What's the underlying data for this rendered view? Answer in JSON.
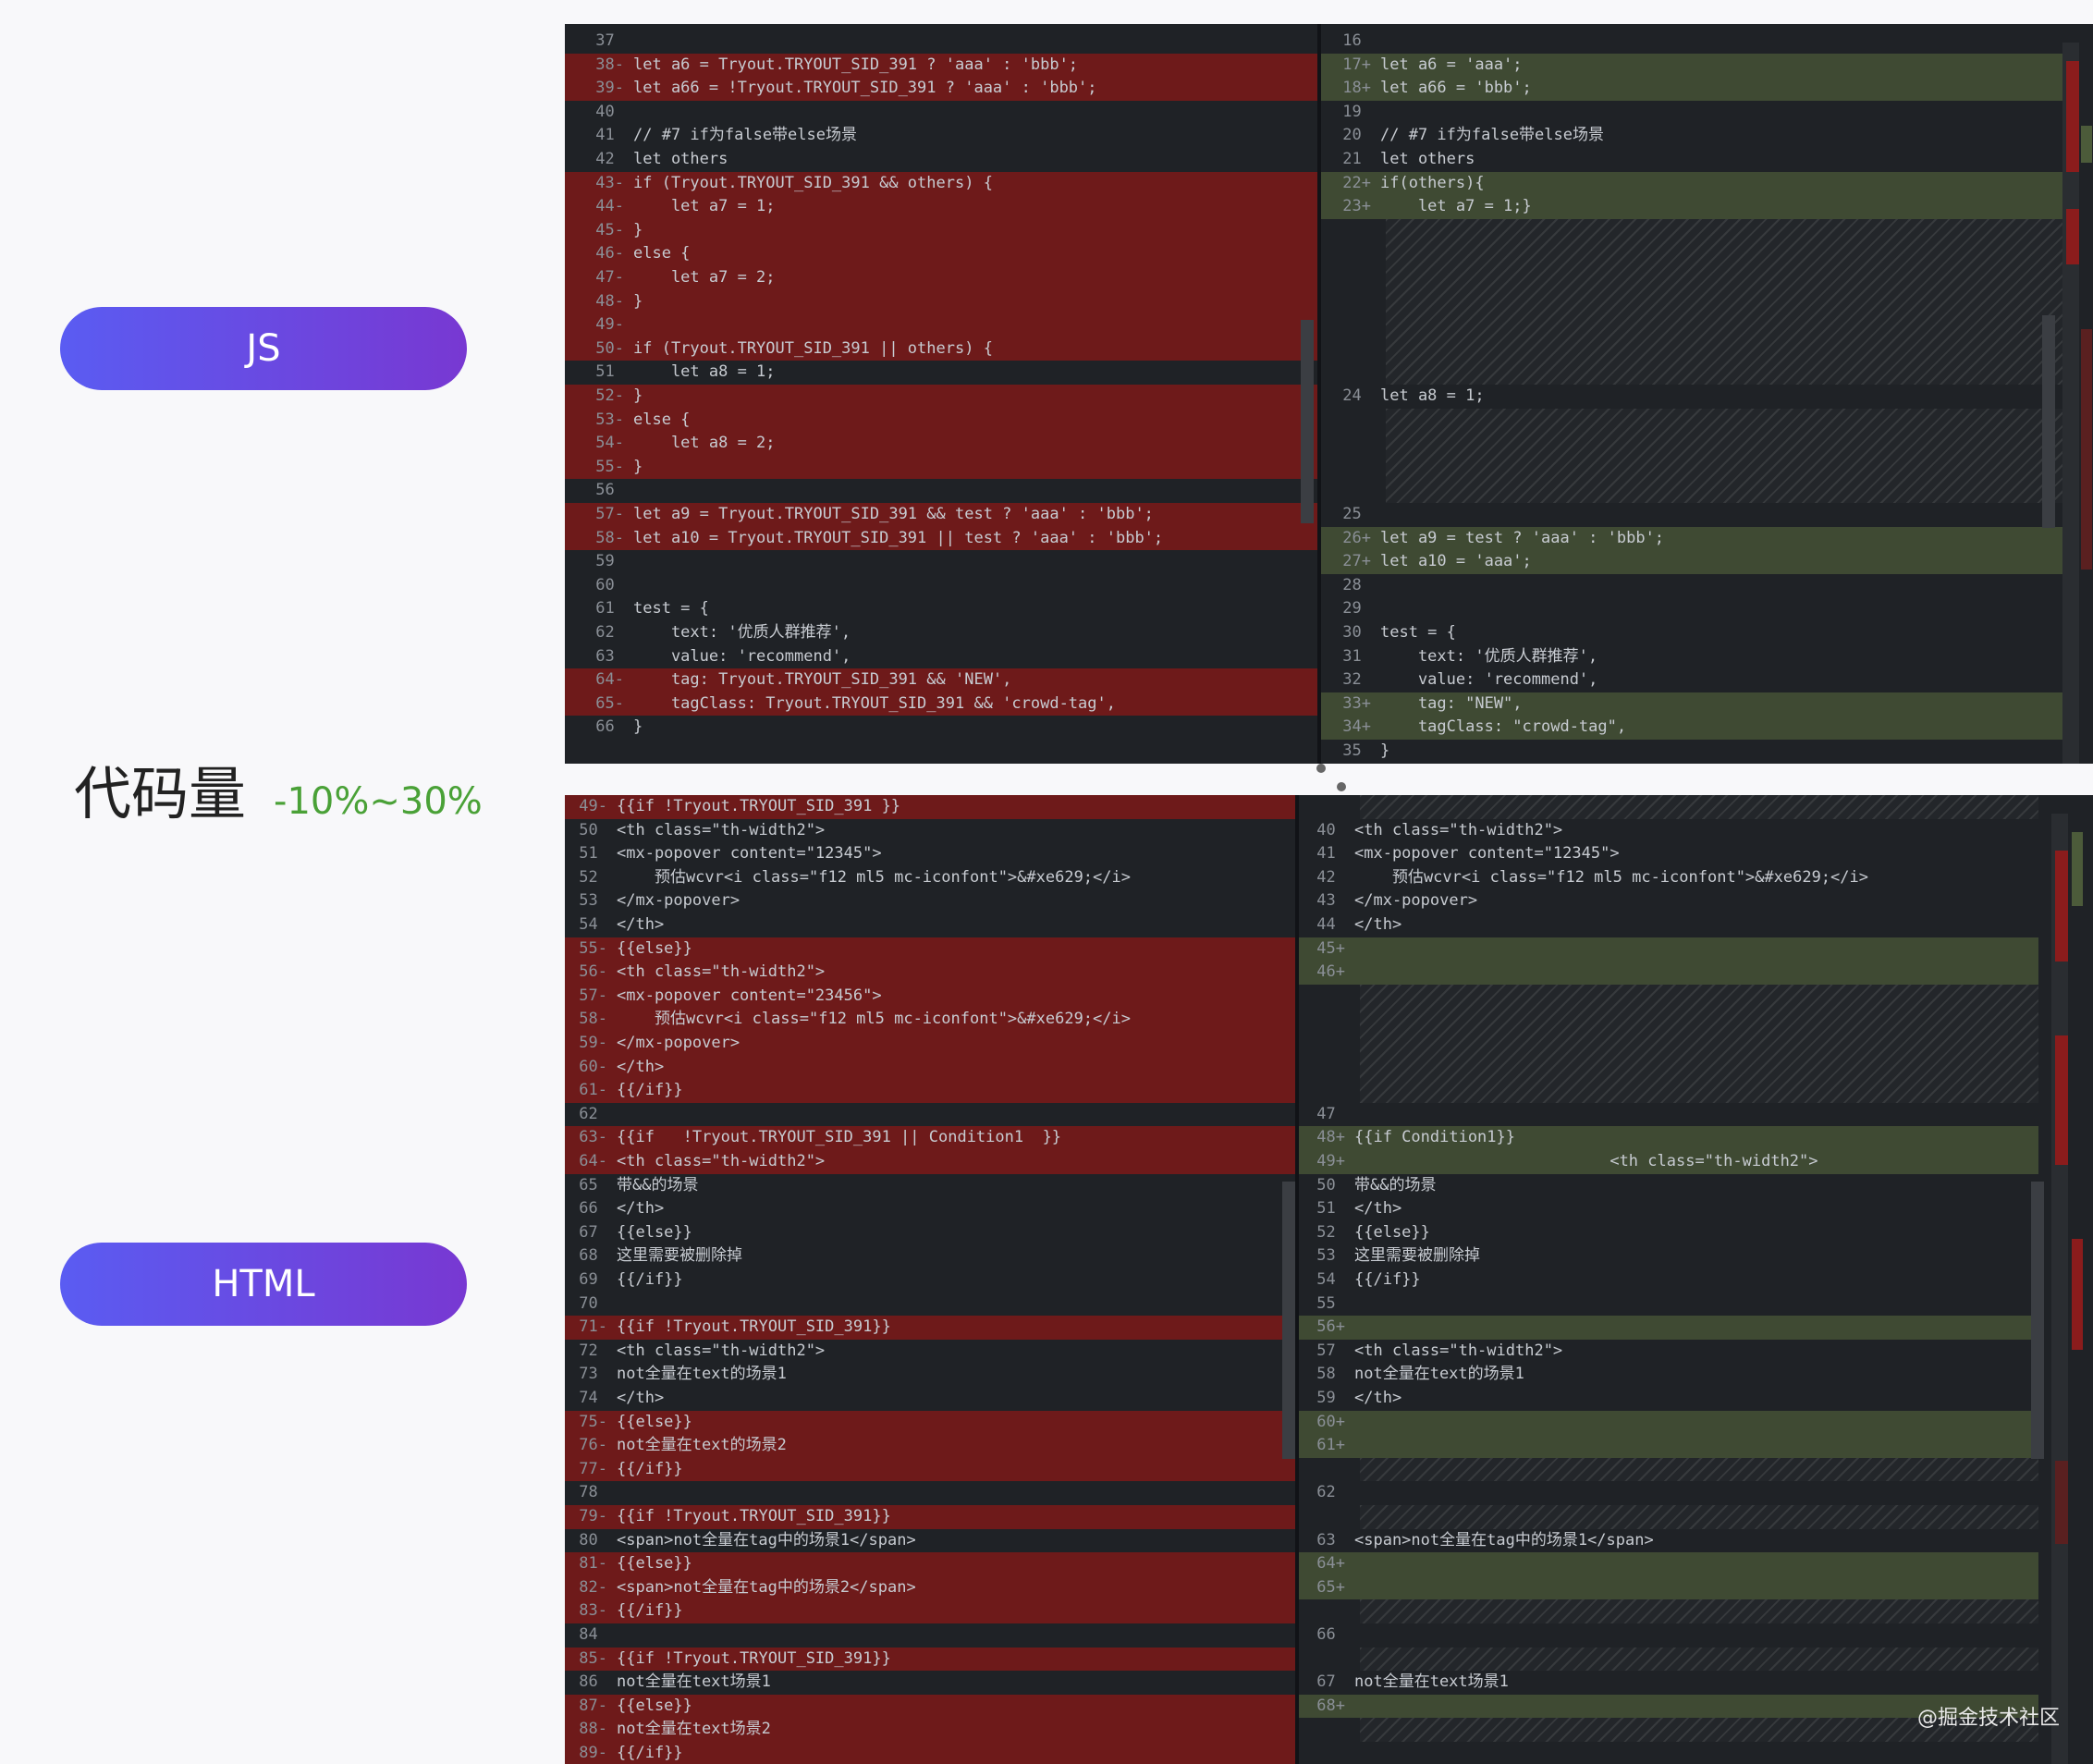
{
  "labels": {
    "js": "JS",
    "html": "HTML",
    "metric_name": "代码量",
    "metric_value": "-10%~30%"
  },
  "watermark": "@掘金技术社区",
  "js_diff": {
    "left": [
      {
        "n": "37",
        "t": "",
        "k": "ctx"
      },
      {
        "n": "38",
        "m": "-",
        "t": "let a6 = Tryout.TRYOUT_SID_391 ? 'aaa' : 'bbb';",
        "k": "del"
      },
      {
        "n": "39",
        "m": "-",
        "t": "let a66 = !Tryout.TRYOUT_SID_391 ? 'aaa' : 'bbb';",
        "k": "del"
      },
      {
        "n": "40",
        "t": "",
        "k": "ctx"
      },
      {
        "n": "41",
        "t": "// #7 if为false带else场景",
        "k": "ctx"
      },
      {
        "n": "42",
        "t": "let others",
        "k": "ctx"
      },
      {
        "n": "43",
        "m": "-",
        "t": "if (Tryout.TRYOUT_SID_391 && others) {",
        "k": "del"
      },
      {
        "n": "44",
        "m": "-",
        "t": "    let a7 = 1;",
        "k": "del"
      },
      {
        "n": "45",
        "m": "-",
        "t": "}",
        "k": "del"
      },
      {
        "n": "46",
        "m": "-",
        "t": "else {",
        "k": "del"
      },
      {
        "n": "47",
        "m": "-",
        "t": "    let a7 = 2;",
        "k": "del"
      },
      {
        "n": "48",
        "m": "-",
        "t": "}",
        "k": "del"
      },
      {
        "n": "49",
        "m": "-",
        "t": "",
        "k": "del"
      },
      {
        "n": "50",
        "m": "-",
        "t": "if (Tryout.TRYOUT_SID_391 || others) {",
        "k": "del"
      },
      {
        "n": "51",
        "t": "    let a8 = 1;",
        "k": "ctx"
      },
      {
        "n": "52",
        "m": "-",
        "t": "}",
        "k": "del"
      },
      {
        "n": "53",
        "m": "-",
        "t": "else {",
        "k": "del"
      },
      {
        "n": "54",
        "m": "-",
        "t": "    let a8 = 2;",
        "k": "del"
      },
      {
        "n": "55",
        "m": "-",
        "t": "}",
        "k": "del"
      },
      {
        "n": "56",
        "t": "",
        "k": "ctx"
      },
      {
        "n": "57",
        "m": "-",
        "t": "let a9 = Tryout.TRYOUT_SID_391 && test ? 'aaa' : 'bbb';",
        "k": "del"
      },
      {
        "n": "58",
        "m": "-",
        "t": "let a10 = Tryout.TRYOUT_SID_391 || test ? 'aaa' : 'bbb';",
        "k": "del"
      },
      {
        "n": "59",
        "t": "",
        "k": "ctx"
      },
      {
        "n": "60",
        "t": "",
        "k": "ctx"
      },
      {
        "n": "61",
        "t": "test = {",
        "k": "ctx"
      },
      {
        "n": "62",
        "t": "    text: '优质人群推荐',",
        "k": "ctx"
      },
      {
        "n": "63",
        "t": "    value: 'recommend',",
        "k": "ctx"
      },
      {
        "n": "64",
        "m": "-",
        "t": "    tag: Tryout.TRYOUT_SID_391 && 'NEW',",
        "k": "del"
      },
      {
        "n": "65",
        "m": "-",
        "t": "    tagClass: Tryout.TRYOUT_SID_391 && 'crowd-tag',",
        "k": "del"
      },
      {
        "n": "66",
        "t": "}",
        "k": "ctx"
      }
    ],
    "right": [
      {
        "n": "16",
        "t": "",
        "k": "ctx"
      },
      {
        "n": "17",
        "m": "+",
        "t": "let a6 = 'aaa';",
        "k": "add"
      },
      {
        "n": "18",
        "m": "+",
        "t": "let a66 = 'bbb';",
        "k": "add"
      },
      {
        "n": "19",
        "t": "",
        "k": "ctx"
      },
      {
        "n": "20",
        "t": "// #7 if为false带else场景",
        "k": "ctx"
      },
      {
        "n": "21",
        "t": "let others",
        "k": "ctx"
      },
      {
        "n": "22",
        "m": "+",
        "t": "if(others){",
        "k": "add"
      },
      {
        "n": "23",
        "m": "+",
        "t": "    let a7 = 1;}",
        "k": "add"
      },
      {
        "gap": 7
      },
      {
        "n": "24",
        "t": "let a8 = 1;",
        "k": "ctx"
      },
      {
        "gap": 4
      },
      {
        "n": "25",
        "t": "",
        "k": "ctx"
      },
      {
        "n": "26",
        "m": "+",
        "t": "let a9 = test ? 'aaa' : 'bbb';",
        "k": "add"
      },
      {
        "n": "27",
        "m": "+",
        "t": "let a10 = 'aaa';",
        "k": "add"
      },
      {
        "n": "28",
        "t": "",
        "k": "ctx"
      },
      {
        "n": "29",
        "t": "",
        "k": "ctx"
      },
      {
        "n": "30",
        "t": "test = {",
        "k": "ctx"
      },
      {
        "n": "31",
        "t": "    text: '优质人群推荐',",
        "k": "ctx"
      },
      {
        "n": "32",
        "t": "    value: 'recommend',",
        "k": "ctx"
      },
      {
        "n": "33",
        "m": "+",
        "t": "    tag: \"NEW\",",
        "k": "add"
      },
      {
        "n": "34",
        "m": "+",
        "t": "    tagClass: \"crowd-tag\",",
        "k": "add"
      },
      {
        "n": "35",
        "t": "}",
        "k": "ctx"
      }
    ]
  },
  "html_diff": {
    "left": [
      {
        "n": "49",
        "m": "-",
        "t": "{{if !Tryout.TRYOUT_SID_391 }}",
        "k": "del"
      },
      {
        "n": "50",
        "t": "<th class=\"th-width2\">",
        "k": "ctx"
      },
      {
        "n": "51",
        "t": "<mx-popover content=\"12345\">",
        "k": "ctx"
      },
      {
        "n": "52",
        "t": "    预估wcvr<i class=\"f12 ml5 mc-iconfont\">&#xe629;</i>",
        "k": "ctx"
      },
      {
        "n": "53",
        "t": "</mx-popover>",
        "k": "ctx"
      },
      {
        "n": "54",
        "t": "</th>",
        "k": "ctx"
      },
      {
        "n": "55",
        "m": "-",
        "t": "{{else}}",
        "k": "del"
      },
      {
        "n": "56",
        "m": "-",
        "t": "<th class=\"th-width2\">",
        "k": "del"
      },
      {
        "n": "57",
        "m": "-",
        "t": "<mx-popover content=\"23456\">",
        "k": "del"
      },
      {
        "n": "58",
        "m": "-",
        "t": "    预估wcvr<i class=\"f12 ml5 mc-iconfont\">&#xe629;</i>",
        "k": "del"
      },
      {
        "n": "59",
        "m": "-",
        "t": "</mx-popover>",
        "k": "del"
      },
      {
        "n": "60",
        "m": "-",
        "t": "</th>",
        "k": "del"
      },
      {
        "n": "61",
        "m": "-",
        "t": "{{/if}}",
        "k": "del"
      },
      {
        "n": "62",
        "t": "",
        "k": "ctx"
      },
      {
        "n": "63",
        "m": "-",
        "t": "{{if   !Tryout.TRYOUT_SID_391 || Condition1  }}",
        "k": "del"
      },
      {
        "n": "64",
        "m": "-",
        "t": "<th class=\"th-width2\">",
        "k": "del"
      },
      {
        "n": "65",
        "t": "带&&的场景",
        "k": "ctx"
      },
      {
        "n": "66",
        "t": "</th>",
        "k": "ctx"
      },
      {
        "n": "67",
        "t": "{{else}}",
        "k": "ctx"
      },
      {
        "n": "68",
        "t": "这里需要被删除掉",
        "k": "ctx"
      },
      {
        "n": "69",
        "t": "{{/if}}",
        "k": "ctx"
      },
      {
        "n": "70",
        "t": "",
        "k": "ctx"
      },
      {
        "n": "71",
        "m": "-",
        "t": "{{if !Tryout.TRYOUT_SID_391}}",
        "k": "del"
      },
      {
        "n": "72",
        "t": "<th class=\"th-width2\">",
        "k": "ctx"
      },
      {
        "n": "73",
        "t": "not全量在text的场景1",
        "k": "ctx"
      },
      {
        "n": "74",
        "t": "</th>",
        "k": "ctx"
      },
      {
        "n": "75",
        "m": "-",
        "t": "{{else}}",
        "k": "del"
      },
      {
        "n": "76",
        "m": "-",
        "t": "not全量在text的场景2",
        "k": "del"
      },
      {
        "n": "77",
        "m": "-",
        "t": "{{/if}}",
        "k": "del"
      },
      {
        "n": "78",
        "t": "",
        "k": "ctx"
      },
      {
        "n": "79",
        "m": "-",
        "t": "{{if !Tryout.TRYOUT_SID_391}}",
        "k": "del"
      },
      {
        "n": "80",
        "t": "<span>not全量在tag中的场景1</span>",
        "k": "ctx"
      },
      {
        "n": "81",
        "m": "-",
        "t": "{{else}}",
        "k": "del"
      },
      {
        "n": "82",
        "m": "-",
        "t": "<span>not全量在tag中的场景2</span>",
        "k": "del"
      },
      {
        "n": "83",
        "m": "-",
        "t": "{{/if}}",
        "k": "del"
      },
      {
        "n": "84",
        "t": "",
        "k": "ctx"
      },
      {
        "n": "85",
        "m": "-",
        "t": "{{if !Tryout.TRYOUT_SID_391}}",
        "k": "del"
      },
      {
        "n": "86",
        "t": "not全量在text场景1",
        "k": "ctx"
      },
      {
        "n": "87",
        "m": "-",
        "t": "{{else}}",
        "k": "del"
      },
      {
        "n": "88",
        "m": "-",
        "t": "not全量在text场景2",
        "k": "del"
      },
      {
        "n": "89",
        "m": "-",
        "t": "{{/if}}",
        "k": "del"
      }
    ],
    "right": [
      {
        "gap": 1
      },
      {
        "n": "40",
        "t": "<th class=\"th-width2\">",
        "k": "ctx"
      },
      {
        "n": "41",
        "t": "<mx-popover content=\"12345\">",
        "k": "ctx"
      },
      {
        "n": "42",
        "t": "    预估wcvr<i class=\"f12 ml5 mc-iconfont\">&#xe629;</i>",
        "k": "ctx"
      },
      {
        "n": "43",
        "t": "</mx-popover>",
        "k": "ctx"
      },
      {
        "n": "44",
        "t": "</th>",
        "k": "ctx"
      },
      {
        "n": "45",
        "m": "+",
        "t": "",
        "k": "add"
      },
      {
        "n": "46",
        "m": "+",
        "t": "",
        "k": "add"
      },
      {
        "gap": 5
      },
      {
        "n": "47",
        "t": "",
        "k": "ctx"
      },
      {
        "n": "48",
        "m": "+",
        "t": "{{if Condition1}}",
        "k": "add"
      },
      {
        "n": "49",
        "m": "+",
        "t": "                           <th class=\"th-width2\">",
        "k": "add"
      },
      {
        "n": "50",
        "t": "带&&的场景",
        "k": "ctx"
      },
      {
        "n": "51",
        "t": "</th>",
        "k": "ctx"
      },
      {
        "n": "52",
        "t": "{{else}}",
        "k": "ctx"
      },
      {
        "n": "53",
        "t": "这里需要被删除掉",
        "k": "ctx"
      },
      {
        "n": "54",
        "t": "{{/if}}",
        "k": "ctx"
      },
      {
        "n": "55",
        "t": "",
        "k": "ctx"
      },
      {
        "n": "56",
        "m": "+",
        "t": "",
        "k": "add"
      },
      {
        "n": "57",
        "t": "<th class=\"th-width2\">",
        "k": "ctx"
      },
      {
        "n": "58",
        "t": "not全量在text的场景1",
        "k": "ctx"
      },
      {
        "n": "59",
        "t": "</th>",
        "k": "ctx"
      },
      {
        "n": "60",
        "m": "+",
        "t": "",
        "k": "add"
      },
      {
        "n": "61",
        "m": "+",
        "t": "",
        "k": "add"
      },
      {
        "gap": 1
      },
      {
        "n": "62",
        "t": "",
        "k": "ctx"
      },
      {
        "gap": 1
      },
      {
        "n": "63",
        "t": "<span>not全量在tag中的场景1</span>",
        "k": "ctx"
      },
      {
        "n": "64",
        "m": "+",
        "t": "",
        "k": "add"
      },
      {
        "n": "65",
        "m": "+",
        "t": "",
        "k": "add"
      },
      {
        "gap": 1
      },
      {
        "n": "66",
        "t": "",
        "k": "ctx"
      },
      {
        "gap": 1
      },
      {
        "n": "67",
        "t": "not全量在text场景1",
        "k": "ctx"
      },
      {
        "n": "68",
        "m": "+",
        "t": "",
        "k": "add"
      },
      {
        "gap": 1
      }
    ]
  },
  "colors": {
    "accent_start": "#5a5cf2",
    "accent_end": "#7838d2",
    "metric_value": "#4aa137",
    "deleted_bg": "#6e1a1a",
    "added_bg": "#3f4a33",
    "editor_bg": "#1f2226"
  }
}
